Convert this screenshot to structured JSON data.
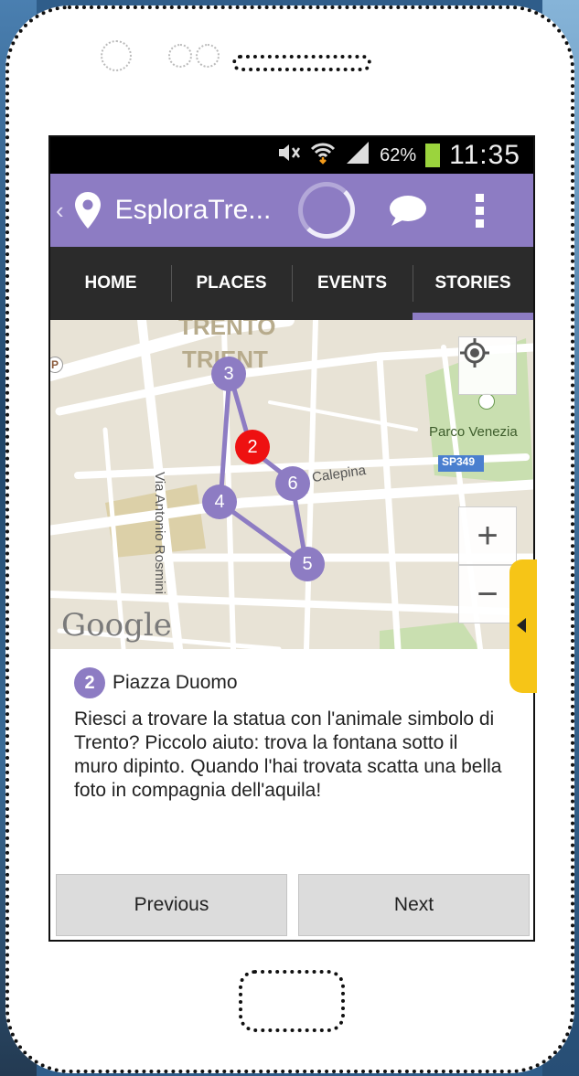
{
  "status_bar": {
    "battery_percent": "62%",
    "time": "11:35"
  },
  "action_bar": {
    "back_glyph": "‹",
    "title": "EsploraTre..."
  },
  "tabs": [
    {
      "label": "HOME",
      "active": false
    },
    {
      "label": "PLACES",
      "active": false
    },
    {
      "label": "EVENTS",
      "active": false
    },
    {
      "label": "STORIES",
      "active": true
    }
  ],
  "map": {
    "labels": {
      "city_1": "TRENTO",
      "city_2": "TRIENT",
      "park": "Parco Venezia",
      "road_shield": "SP349",
      "street_1": "Calepina",
      "street_2": "Via Antonio Rosmini",
      "parking": "P",
      "provider": "Google"
    },
    "markers": [
      {
        "label": "3",
        "active": false
      },
      {
        "label": "2",
        "active": true
      },
      {
        "label": "6",
        "active": false
      },
      {
        "label": "4",
        "active": false
      },
      {
        "label": "5",
        "active": false
      }
    ],
    "zoom_in_label": "+",
    "zoom_out_label": "−",
    "colors": {
      "route": "#8d7cc3",
      "active_marker": "#ee1111"
    }
  },
  "poi": {
    "number": "2",
    "title": "Piazza Duomo",
    "description": "Riesci a trovare la statua con l'animale simbolo di Trento? Piccolo aiuto: trova la fontana sotto il muro dipinto. Quando l'hai trovata scatta una bella foto in compagnia dell'aquila!"
  },
  "navigation": {
    "previous_label": "Previous",
    "next_label": "Next"
  },
  "icons": [
    "mute-icon",
    "wifi-icon",
    "signal-icon",
    "battery-icon",
    "pin-icon",
    "chat-icon",
    "overflow-menu-icon",
    "my-location-icon"
  ]
}
